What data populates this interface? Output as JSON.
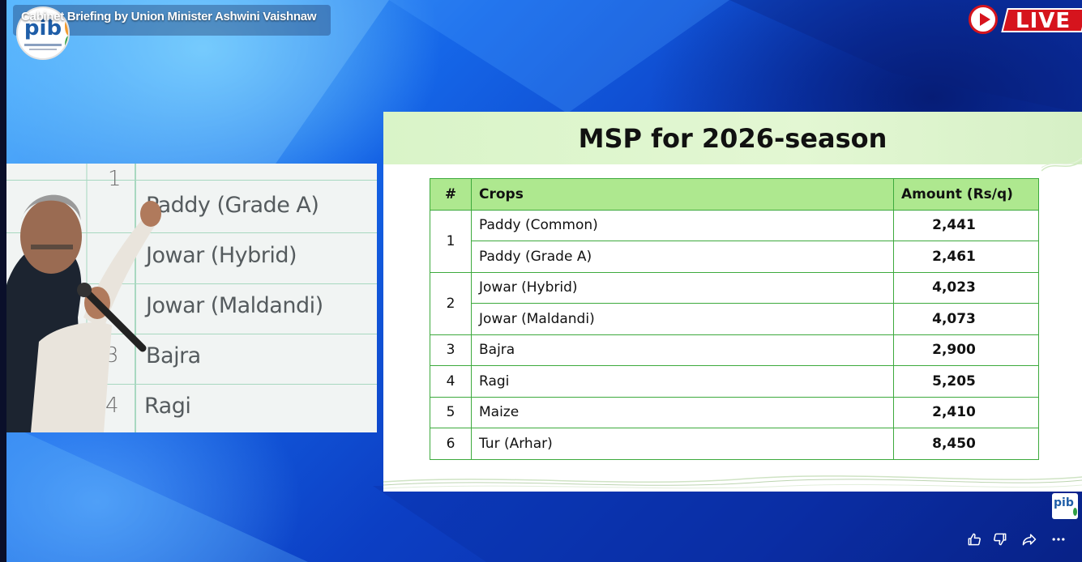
{
  "stream": {
    "title": "Cabinet Briefing by Union Minister Ashwini Vaishnaw",
    "logo_text": "pib",
    "live_label": "LIVE"
  },
  "camera_view": {
    "rows": [
      {
        "num": "1",
        "crop": ""
      },
      {
        "num": "",
        "crop": "Paddy (Grade A)"
      },
      {
        "num": "2",
        "crop": "Jowar (Hybrid)"
      },
      {
        "num": "",
        "crop": "Jowar (Maldandi)"
      },
      {
        "num": "3",
        "crop": "Bajra"
      },
      {
        "num": "4",
        "crop": "Ragi"
      }
    ]
  },
  "slide": {
    "title": "MSP for 2026-season",
    "headers": {
      "num": "#",
      "crop": "Crops",
      "amount": "Amount (Rs/q)"
    },
    "rows": [
      {
        "num": "1",
        "crop": "Paddy (Common)",
        "amount": "2,441"
      },
      {
        "num": "",
        "crop": "Paddy (Grade A)",
        "amount": "2,461"
      },
      {
        "num": "2",
        "crop": "Jowar (Hybrid)",
        "amount": "4,023"
      },
      {
        "num": "",
        "crop": "Jowar (Maldandi)",
        "amount": "4,073"
      },
      {
        "num": "3",
        "crop": "Bajra",
        "amount": "2,900"
      },
      {
        "num": "4",
        "crop": "Ragi",
        "amount": "5,205"
      },
      {
        "num": "5",
        "crop": "Maize",
        "amount": "2,410"
      },
      {
        "num": "6",
        "crop": "Tur (Arhar)",
        "amount": "8,450"
      }
    ]
  },
  "actions": {
    "like": "thumbs-up-icon",
    "dislike": "thumbs-down-icon",
    "share": "share-icon",
    "more": "more-icon"
  },
  "colors": {
    "header_green": "#aee88f",
    "border_green": "#3daa3d",
    "live_red": "#d6141d",
    "background_blue": "#0c3fc4"
  }
}
